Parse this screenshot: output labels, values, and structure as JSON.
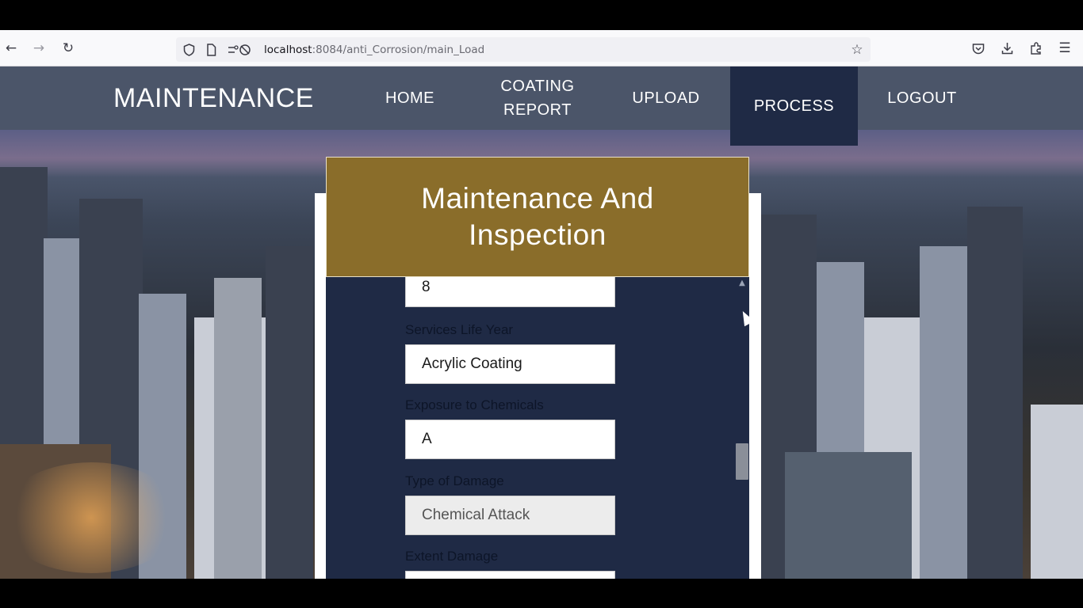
{
  "browser": {
    "url_host": "localhost",
    "url_rest": ":8084/anti_Corrosion/main_Load",
    "icons": {
      "back": "arrow-left-icon",
      "forward": "arrow-right-icon",
      "reload": "reload-icon",
      "shield": "shield-icon",
      "page": "page-icon",
      "permissions": "permissions-icon",
      "bookmark": "star-icon",
      "pocket": "pocket-icon",
      "download": "download-icon",
      "extensions": "extensions-icon",
      "menu": "hamburger-menu-icon"
    }
  },
  "nav": {
    "brand": "MAINTENANCE",
    "items": [
      {
        "label": "HOME"
      },
      {
        "label_line1": "COATING",
        "label_line2": "REPORT"
      },
      {
        "label": "UPLOAD"
      },
      {
        "label": "PROCESS",
        "active": true
      },
      {
        "label": "LOGOUT"
      }
    ]
  },
  "card": {
    "title_line1": "Maintenance And",
    "title_line2": "Inspection",
    "header_color": "#8a6d2a",
    "body_color": "#1f2a45"
  },
  "form": {
    "first_value": "8",
    "fields": [
      {
        "label": "Services Life Year",
        "value": "Acrylic Coating"
      },
      {
        "label": "Exposure to Chemicals",
        "value": "A"
      },
      {
        "label": "Type of Damage",
        "value": "Chemical Attack"
      },
      {
        "label": "Extent Damage",
        "value": ""
      }
    ]
  },
  "colors": {
    "navbar": "#4b5569",
    "nav_active": "#1f2a45"
  }
}
